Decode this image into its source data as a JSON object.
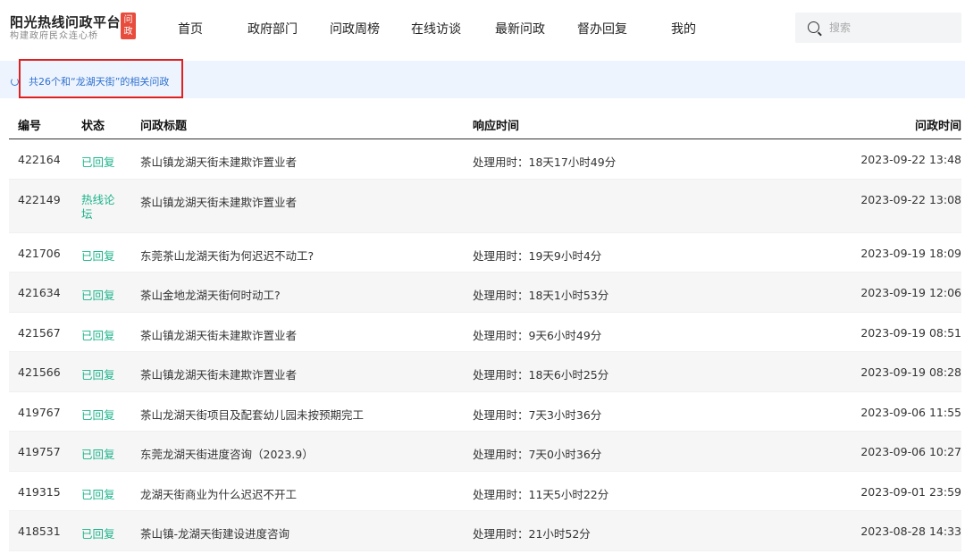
{
  "header": {
    "logo_title": "阳光热线问政平台",
    "logo_sub": "构建政府民众连心桥",
    "logo_badge": "问政",
    "nav": [
      "首页",
      "政府部门",
      "问政周榜",
      "在线访谈",
      "最新问政",
      "督办回复",
      "我的"
    ],
    "search_placeholder": "搜索"
  },
  "result": {
    "text": "共26个和“龙湖天街”的相关问政"
  },
  "table": {
    "headers": [
      "编号",
      "状态",
      "问政标题",
      "响应时间",
      "问政时间"
    ],
    "rows": [
      {
        "id": "422164",
        "status": "已回复",
        "title": "茶山镇龙湖天街未建欺诈置业者",
        "response": "处理用时：18天17小时49分",
        "date": "2023-09-22 13:48"
      },
      {
        "id": "422149",
        "status": "热线论坛",
        "title": "茶山镇龙湖天街未建欺诈置业者",
        "response": "",
        "date": "2023-09-22 13:08"
      },
      {
        "id": "421706",
        "status": "已回复",
        "title": "东莞茶山龙湖天街为何迟迟不动工?",
        "response": "处理用时：19天9小时4分",
        "date": "2023-09-19 18:09"
      },
      {
        "id": "421634",
        "status": "已回复",
        "title": "茶山金地龙湖天街何时动工?",
        "response": "处理用时：18天1小时53分",
        "date": "2023-09-19 12:06"
      },
      {
        "id": "421567",
        "status": "已回复",
        "title": "茶山镇龙湖天街未建欺诈置业者",
        "response": "处理用时：9天6小时49分",
        "date": "2023-09-19 08:51"
      },
      {
        "id": "421566",
        "status": "已回复",
        "title": "茶山镇龙湖天街未建欺诈置业者",
        "response": "处理用时：18天6小时25分",
        "date": "2023-09-19 08:28"
      },
      {
        "id": "419767",
        "status": "已回复",
        "title": "茶山龙湖天街项目及配套幼儿园未按预期完工",
        "response": "处理用时：7天3小时36分",
        "date": "2023-09-06 11:55"
      },
      {
        "id": "419757",
        "status": "已回复",
        "title": "东莞龙湖天街进度咨询（2023.9）",
        "response": "处理用时：7天0小时36分",
        "date": "2023-09-06 10:27"
      },
      {
        "id": "419315",
        "status": "已回复",
        "title": "龙湖天街商业为什么迟迟不开工",
        "response": "处理用时：11天5小时22分",
        "date": "2023-09-01 23:59"
      },
      {
        "id": "418531",
        "status": "已回复",
        "title": "茶山镇-龙湖天街建设进度咨询",
        "response": "处理用时：21小时52分",
        "date": "2023-08-28 14:33"
      }
    ]
  }
}
